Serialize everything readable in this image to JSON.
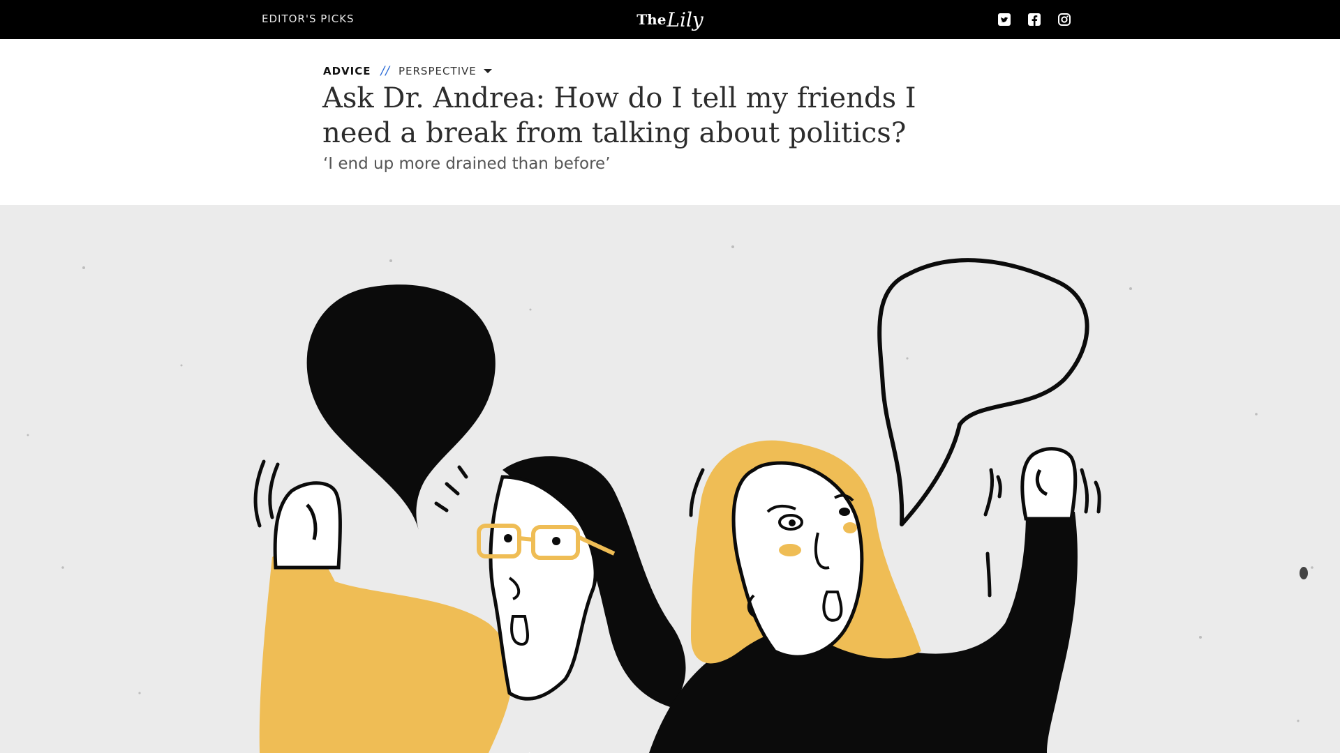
{
  "nav": {
    "editors_picks": "EDITOR'S PICKS",
    "logo_the": "The",
    "logo_lily": "Lily",
    "social_icons": [
      "twitter-icon",
      "facebook-icon",
      "instagram-icon"
    ]
  },
  "article": {
    "category": "ADVICE",
    "separator": "//",
    "label": "PERSPECTIVE",
    "title": "Ask Dr. Andrea: How do I tell my friends I need a break from talking about politics?",
    "dek": "‘I end up more drained than before’"
  },
  "colors": {
    "topbar": "#000000",
    "accent_blue": "#2a6ad6",
    "illustration_yellow": "#efbd55",
    "illustration_background": "#ebebeb"
  }
}
